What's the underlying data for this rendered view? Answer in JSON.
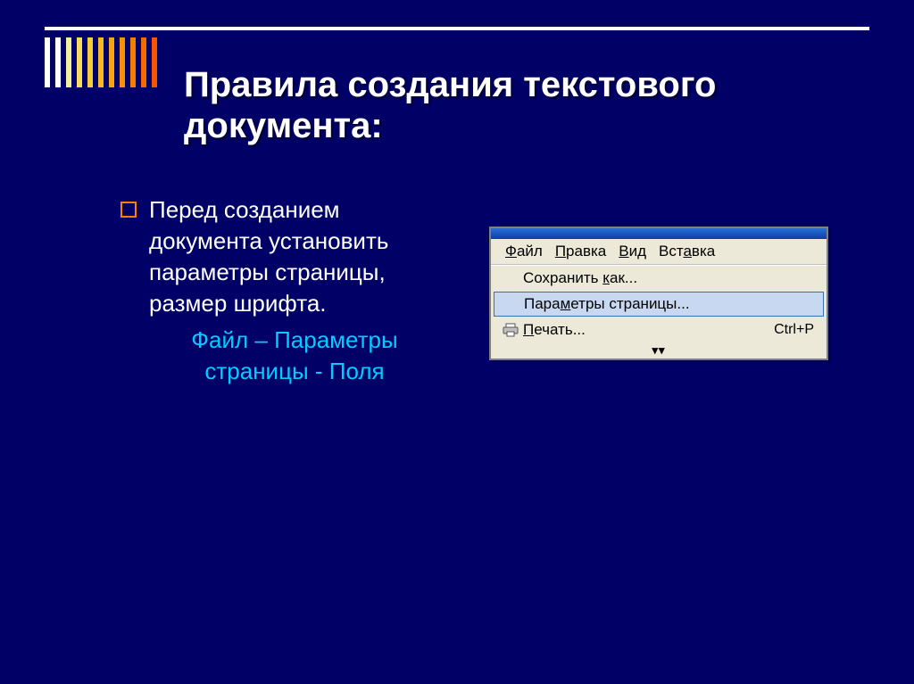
{
  "stripe_colors": [
    "#ffffff",
    "#ffffff",
    "#f3f09a",
    "#f6dd62",
    "#f6cd3c",
    "#f6b924",
    "#f6a414",
    "#f69008",
    "#f67c00",
    "#f66800",
    "#f65400"
  ],
  "title": "Правила создания текстового документа:",
  "bullet_text": "Перед созданием документа установить параметры страницы, размер шрифта.",
  "path_text": "Файл – Параметры страницы - Поля",
  "menu": {
    "bar": {
      "file": {
        "pre": "",
        "u": "Ф",
        "post": "айл"
      },
      "edit": {
        "pre": "",
        "u": "П",
        "post": "равка"
      },
      "view": {
        "pre": "",
        "u": "В",
        "post": "ид"
      },
      "insert": {
        "pre": "Вст",
        "u": "а",
        "post": "вка"
      }
    },
    "items": {
      "save_as": {
        "pre": "Сохранить ",
        "u": "к",
        "post": "ак..."
      },
      "page_setup": {
        "pre": "Пара",
        "u": "м",
        "post": "етры страницы..."
      },
      "print": {
        "pre": "",
        "u": "П",
        "post": "ечать..."
      },
      "print_shortcut": "Ctrl+P"
    },
    "expand_glyph": "▾▾"
  }
}
